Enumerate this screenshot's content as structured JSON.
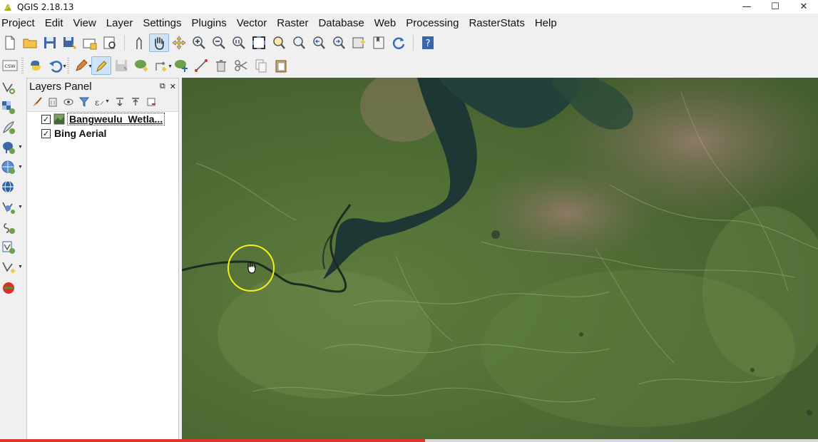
{
  "window": {
    "title": "QGIS 2.18.13",
    "min_glyph": "—",
    "max_glyph": "☐",
    "close_glyph": "✕"
  },
  "menu": [
    "Project",
    "Edit",
    "View",
    "Layer",
    "Settings",
    "Plugins",
    "Vector",
    "Raster",
    "Database",
    "Web",
    "Processing",
    "RasterStats",
    "Help"
  ],
  "toolbar2": {
    "csw_label": "CSW"
  },
  "layers_panel": {
    "title": "Layers Panel",
    "float_glyph": "⧉",
    "close_glyph": "✕",
    "layers": [
      {
        "name": "Bangweulu_Wetla...",
        "checked": true,
        "check_glyph": "✓",
        "type": "raster"
      },
      {
        "name": "Bing Aerial",
        "checked": true,
        "check_glyph": "✓",
        "type": "tile"
      }
    ]
  },
  "video_progress": {
    "fraction": 0.52,
    "color": "#e2352a"
  },
  "colors": {
    "cursor_ring": "#f2ee1a",
    "water": "#1f3a36",
    "vegetation": "#4c6a34"
  }
}
